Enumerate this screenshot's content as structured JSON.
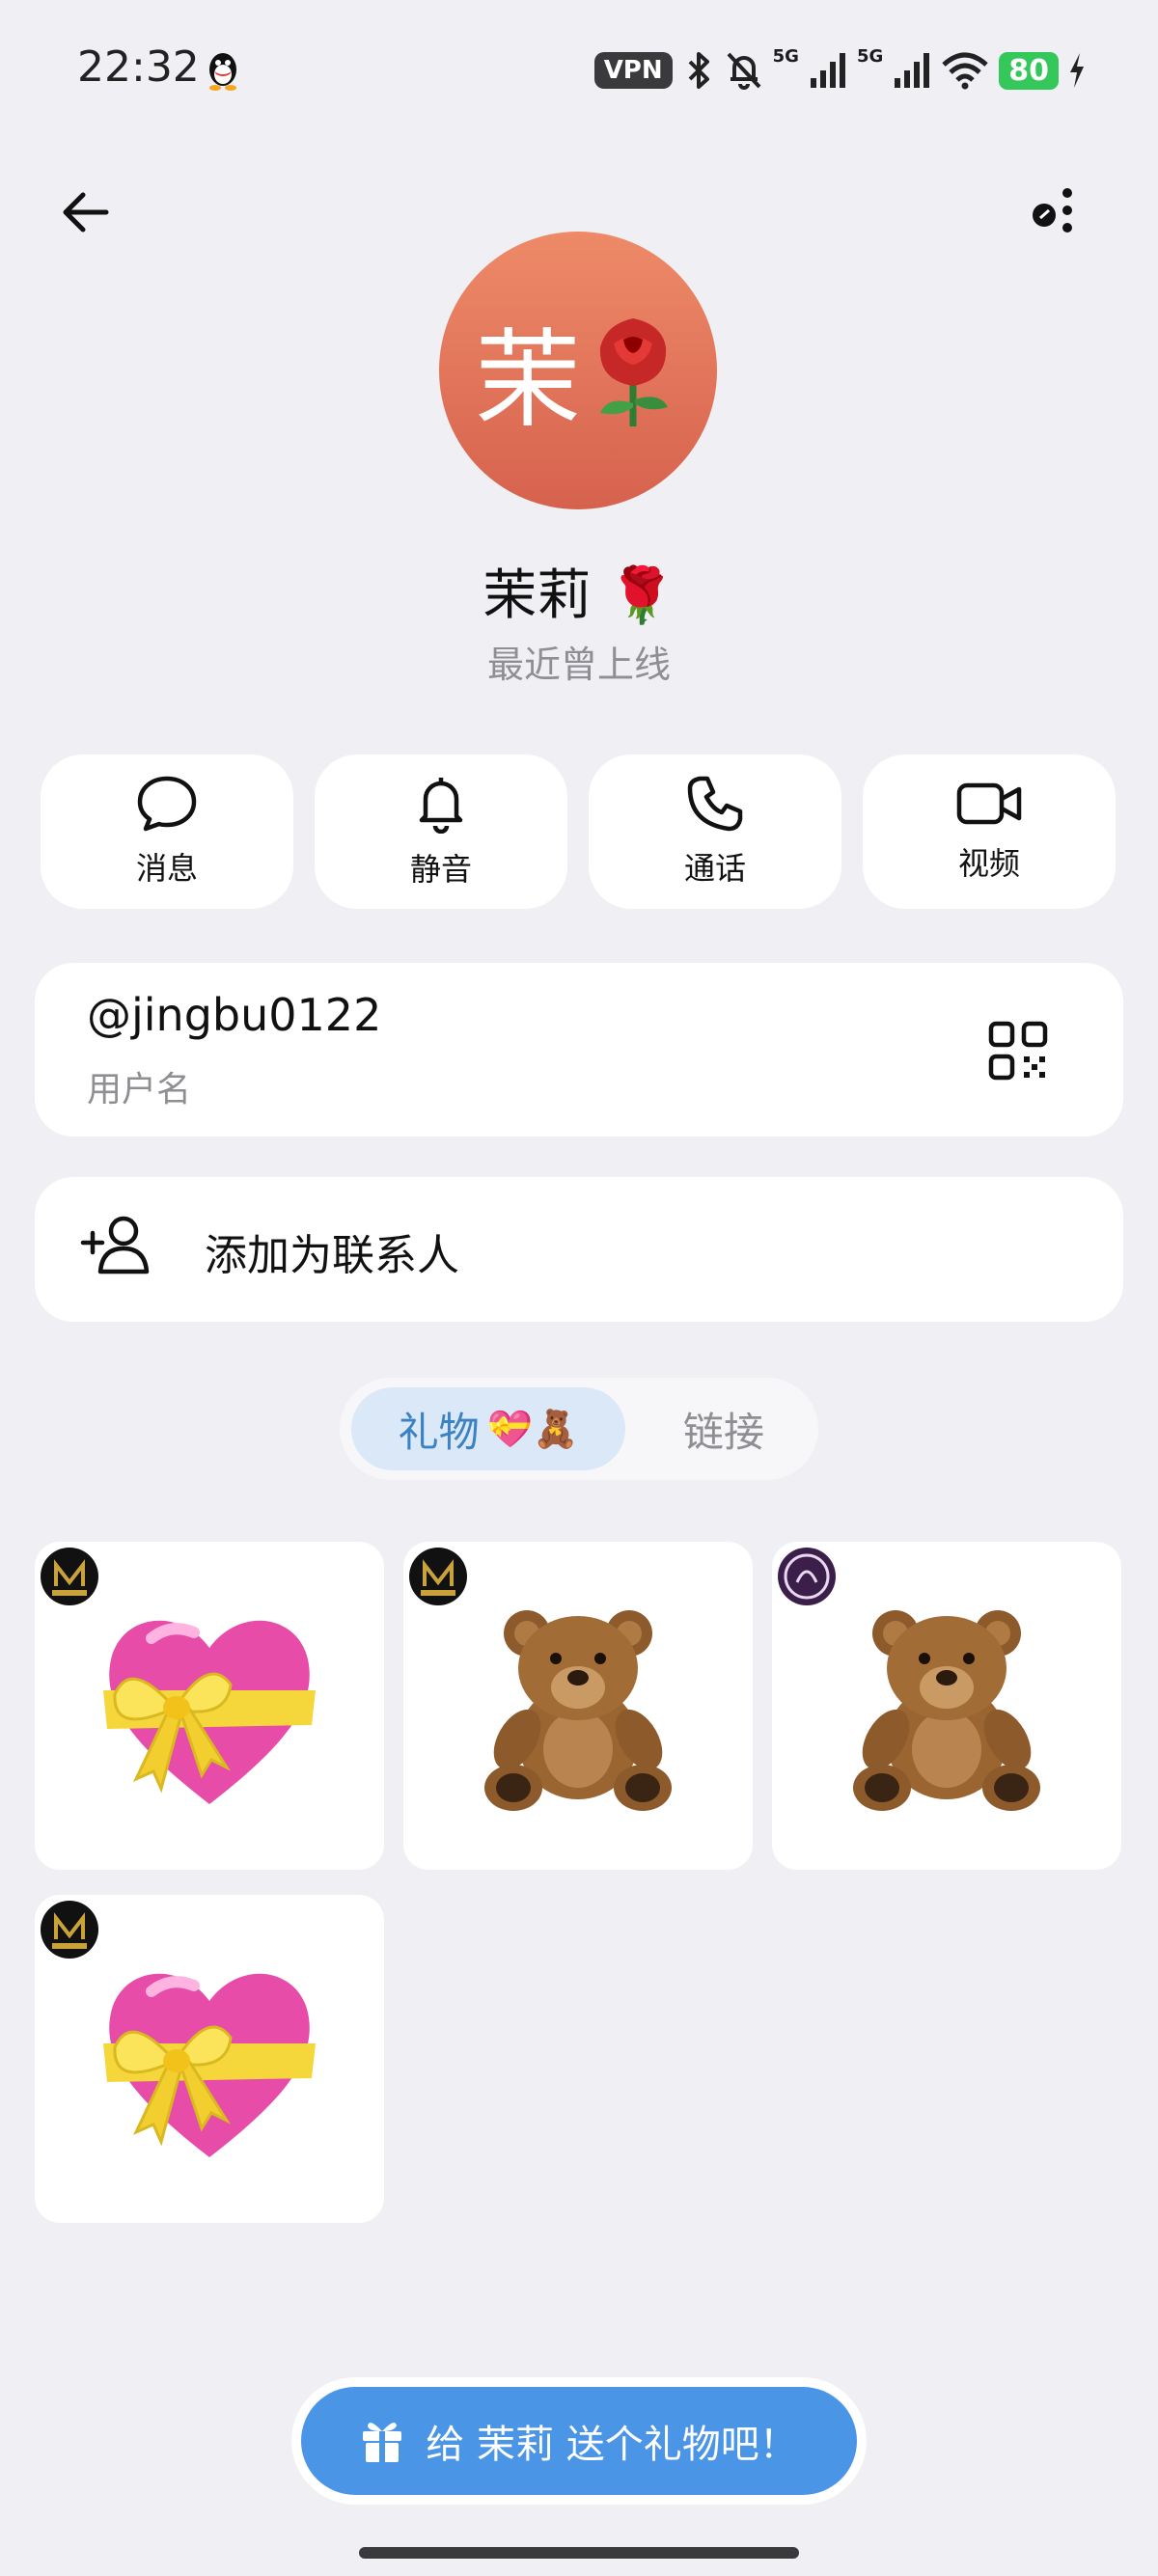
{
  "status_bar": {
    "time": "22:32",
    "vpn": "VPN",
    "signal1": "5G",
    "signal2": "5G",
    "battery": "80"
  },
  "profile": {
    "avatar_initial": "茉",
    "name": "茉莉 🌹",
    "last_seen": "最近曾上线"
  },
  "actions": [
    {
      "label": "消息",
      "icon": "message-icon"
    },
    {
      "label": "静音",
      "icon": "bell-icon"
    },
    {
      "label": "通话",
      "icon": "phone-icon"
    },
    {
      "label": "视频",
      "icon": "video-icon"
    }
  ],
  "username": {
    "value": "@jingbu0122",
    "label": "用户名"
  },
  "add_contact": {
    "label": "添加为联系人"
  },
  "tabs": {
    "gifts": "礼物",
    "gifts_emoji": "💝🧸",
    "links": "链接"
  },
  "gifts": [
    {
      "type": "heart-with-ribbon",
      "badge": "nmc-logo"
    },
    {
      "type": "teddy-bear",
      "badge": "nmc-logo"
    },
    {
      "type": "teddy-bear",
      "badge": "purple-seal-logo"
    },
    {
      "type": "heart-with-ribbon",
      "badge": "nmc-logo"
    }
  ],
  "gift_button": {
    "label": "给 茉莉 送个礼物吧！"
  },
  "colors": {
    "accent": "#4b95e6",
    "tab_active_bg": "#dbe8f7",
    "avatar_top": "#ee8a68",
    "avatar_bottom": "#d6624e",
    "battery": "#34c759"
  }
}
